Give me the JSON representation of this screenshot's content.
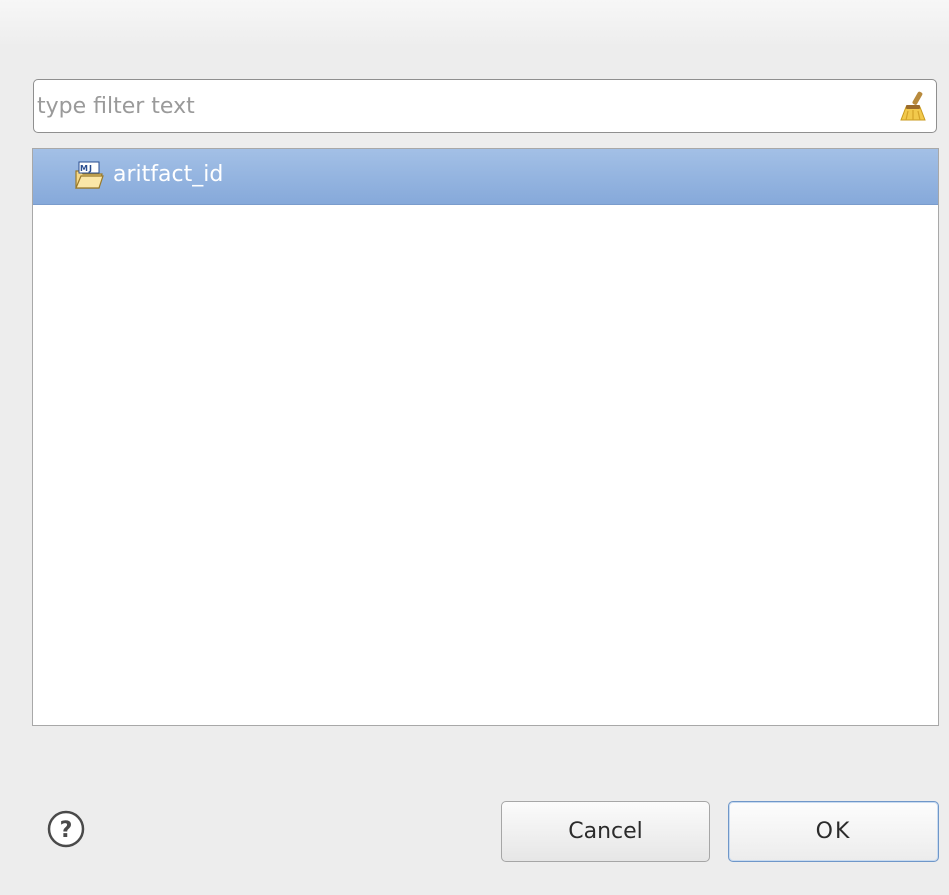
{
  "filter": {
    "value": "",
    "placeholder": "type filter text",
    "clear_icon": "broom-clear-icon"
  },
  "tree": {
    "items": [
      {
        "label": "aritfact_id",
        "icon": "maven-project-folder-icon",
        "selected": true
      }
    ]
  },
  "footer": {
    "help_icon": "help-icon",
    "cancel_label": "Cancel",
    "ok_label": "OK"
  },
  "colors": {
    "selection": "#92b2de",
    "dialog_background": "#ededed",
    "ok_border": "#6f97c9"
  }
}
